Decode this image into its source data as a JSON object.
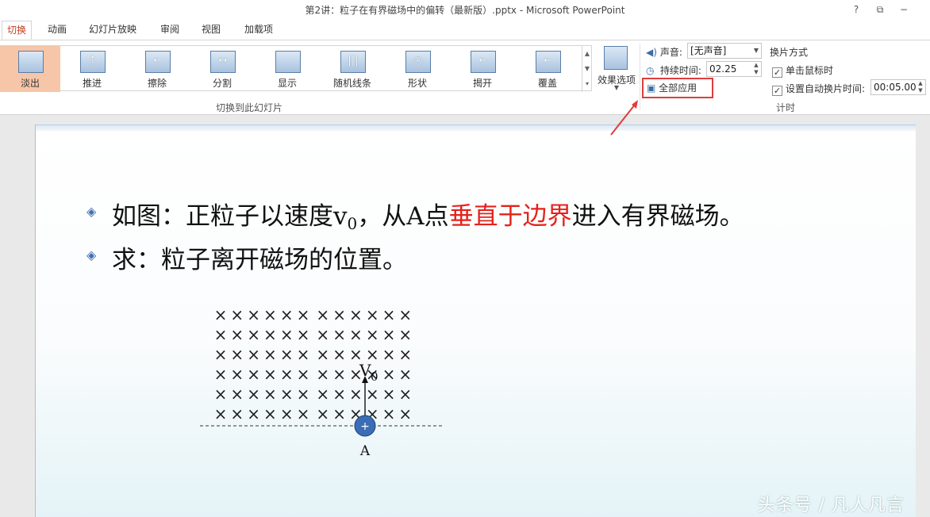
{
  "window": {
    "title": "第2讲：粒子在有界磁场中的偏转（最新版）.pptx - Microsoft PowerPoint",
    "help": "?",
    "restore": "⧉",
    "minimize": "−"
  },
  "tabs": [
    {
      "label": "切换",
      "active": true
    },
    {
      "label": "动画"
    },
    {
      "label": "幻灯片放映"
    },
    {
      "label": "审阅"
    },
    {
      "label": "视图"
    },
    {
      "label": "加载项"
    }
  ],
  "transitions": [
    {
      "label": "淡出",
      "glyph": "",
      "selected": true
    },
    {
      "label": "推进",
      "glyph": "↑"
    },
    {
      "label": "擦除",
      "glyph": "←"
    },
    {
      "label": "分割",
      "glyph": "↔"
    },
    {
      "label": "显示",
      "glyph": ""
    },
    {
      "label": "随机线条",
      "glyph": "|||"
    },
    {
      "label": "形状",
      "glyph": "○"
    },
    {
      "label": "揭开",
      "glyph": "←"
    },
    {
      "label": "覆盖",
      "glyph": "←"
    }
  ],
  "ribbon": {
    "effect_options": "效果选项",
    "group_transition": "切换到此幻灯片",
    "sound_label": "声音:",
    "sound_value": "[无声音]",
    "duration_label": "持续时间:",
    "duration_value": "02.25",
    "apply_all": "全部应用",
    "advance_title": "换片方式",
    "on_click": "单击鼠标时",
    "after_auto": "设置自动换片时间:",
    "after_value": "00:05.00",
    "group_timing": "计时"
  },
  "slide": {
    "line1_pre": "如图：正粒子以速度v",
    "line1_sub": "0",
    "line1_mid": "，从A点",
    "line1_red": "垂直于边界",
    "line1_post": "进入有界磁场。",
    "line2": "求：粒子离开磁场的位置。",
    "diagram": {
      "field_symbol": "×",
      "rows": 6,
      "cols": 12,
      "velocity_label": "V",
      "velocity_sub": "0",
      "charge": "+",
      "point_label": "A"
    }
  },
  "watermark": "头条号 / 凡人凡言",
  "colors": {
    "accent_tab": "#c43e1c",
    "selected_tile": "#f7c6a8",
    "highlight": "#e03c3c",
    "bullet": "#3f6fb4",
    "charge_fill": "#3a6db5"
  }
}
